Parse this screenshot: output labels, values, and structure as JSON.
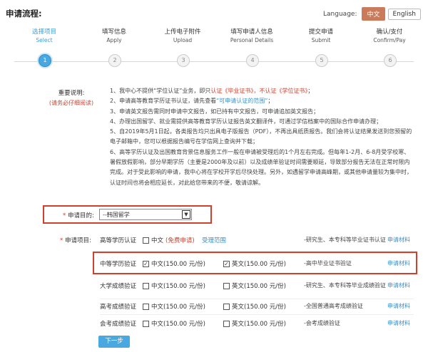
{
  "page": {
    "title": "申请流程:"
  },
  "language": {
    "label": "Language:",
    "options": [
      "中文",
      "English"
    ],
    "selected": "中文"
  },
  "steps": [
    {
      "num": "1",
      "zh": "选择项目",
      "en": "Select"
    },
    {
      "num": "2",
      "zh": "填写信息",
      "en": "Apply"
    },
    {
      "num": "3",
      "zh": "上传电子附件",
      "en": "Upload"
    },
    {
      "num": "4",
      "zh": "填写申请人信息",
      "en": "Personal Details"
    },
    {
      "num": "5",
      "zh": "提交申请",
      "en": "Submit"
    },
    {
      "num": "6",
      "zh": "确认/支付",
      "en": "Confirm/Pay"
    }
  ],
  "notes": {
    "label": "重要说明:",
    "sublabel": "(请务必仔细阅读)",
    "n1a": "1、我中心不提供“学位认证”业务，即只",
    "n1b": "认证《毕业证书》，不认证《学位证书》",
    "n1c": "；",
    "n2a": "2、申请高等教育学历证书认证，请先查看",
    "n2b": "“可申请认证的范围”",
    "n2c": "；",
    "n3": "3、申请英文报告需同时申请中文报告，如已持有中文报告，可申请追加英文报告；",
    "n4": "4、办理出国留学、就业需提供高等教育学历认证报告英文翻译件，可通过学信档案中的国际合作申请办理；",
    "n5": "5、自2019年5月1日起，各类报告均只出具电子版报告（PDF），不再出具纸质报告。我们会将认证结果发送到您预留的电子邮箱中，您可以根据报告编号在学信网上查询并下载；",
    "n6": "6、高等学历认证及出国教育背景信息服务工作一般在申请被受理后的1个月左右完成。但每年1-2月、6-8月受学校寒、暑假放假影响，部分早期学历（主要是2000年及以前）以及成绩单验证时间需要顺延，导致部分报告无法在正常时限内完成。对于受此影响的申请，我中心将在学校开学后尽快处理。另外，如遇留学申请高峰期，或其他申请量较为集中时，认证时间也将会相应延长，对此给您带来的不便，敬请谅解。"
  },
  "purpose": {
    "label": "申请目的:",
    "required_mark": "*",
    "value": "--韩国留学"
  },
  "items": {
    "label": "申请项目:",
    "required_mark": "*",
    "rows": [
      {
        "name": "高等学历认证",
        "zh_label": "中文",
        "zh_note": "(免费申请)",
        "zh_checked": false,
        "link": "受理范围",
        "en_label": "",
        "en_checked": false,
        "desc": "-研究生、本专科等毕业证书认证",
        "material": "申请材料"
      },
      {
        "name": "中等学历验证",
        "zh_label": "中文(150.00 元/份)",
        "zh_checked": true,
        "en_label": "英文(150.00 元/份)",
        "en_checked": true,
        "desc": "-高中毕业证书验证",
        "material": "申请材料"
      },
      {
        "name": "大学成绩验证",
        "zh_label": "中文(150.00 元/份)",
        "zh_checked": false,
        "en_label": "英文(150.00 元/份)",
        "en_checked": false,
        "desc": "-研究生、本专科等毕业成绩验证",
        "material": "申请材料"
      },
      {
        "name": "高考成绩验证",
        "zh_label": "中文(150.00 元/份)",
        "zh_checked": false,
        "en_label": "英文(150.00 元/份)",
        "en_checked": false,
        "desc": "-全国普通高考成绩验证",
        "material": "申请材料"
      },
      {
        "name": "会考成绩验证",
        "zh_label": "中文(150.00 元/份)",
        "zh_checked": false,
        "en_label": "英文(150.00 元/份)",
        "en_checked": false,
        "desc": "-会考成绩验证",
        "material": "申请材料"
      }
    ]
  },
  "next_button": "下一步",
  "checkmark": "✓",
  "colors": {
    "accent": "#4aa8e0",
    "highlight": "#d23f2d",
    "link": "#3a8fc7",
    "lang_active": "#c97b5b"
  }
}
